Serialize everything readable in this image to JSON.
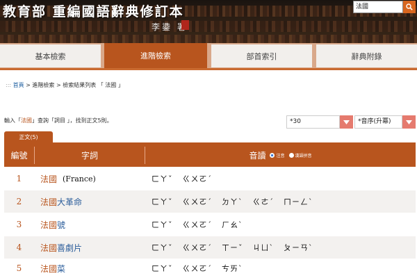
{
  "header": {
    "title": "教育部 重編國語辭典修訂本",
    "author": "李鍌 署",
    "search_value": "法國"
  },
  "nav": {
    "tabs": [
      {
        "label": "基本檢索"
      },
      {
        "label": "進階檢索"
      },
      {
        "label": "部首索引"
      },
      {
        "label": "辭典附錄"
      }
    ]
  },
  "breadcrumb": {
    "dots": ":::",
    "home": "首頁",
    "rest": " > 進階檢索 > 檢索結果列表 「 法國 」"
  },
  "summary": {
    "prefix": "輸入「",
    "term": "法國",
    "middle": "」查詢「詞目 」，找到正文",
    "count": "5",
    "suffix": "則。"
  },
  "controls": {
    "page_size": "*30",
    "sort": "*音序(升冪)"
  },
  "sub_tab": "正文(5)",
  "table": {
    "col_num": "編號",
    "col_word": "字詞",
    "col_sound": "音讀",
    "opt_zhuyin": "注音",
    "opt_pinyin": "漢語拼音",
    "rows": [
      {
        "num": "1",
        "head": "法國",
        "tail": "",
        "note": "(France)",
        "zhuyin": [
          "ㄈㄚˇ",
          "ㄍㄨㄛˊ"
        ]
      },
      {
        "num": "2",
        "head": "法國",
        "tail": "大革命",
        "note": "",
        "zhuyin": [
          "ㄈㄚˇ",
          "ㄍㄨㄛˊ",
          "ㄉㄚˋ",
          "ㄍㄜˊ",
          "ㄇㄧㄥˋ"
        ]
      },
      {
        "num": "3",
        "head": "法國",
        "tail": "號",
        "note": "",
        "zhuyin": [
          "ㄈㄚˇ",
          "ㄍㄨㄛˊ",
          "ㄏㄠˋ"
        ]
      },
      {
        "num": "4",
        "head": "法國",
        "tail": "喜劇片",
        "note": "",
        "zhuyin": [
          "ㄈㄚˇ",
          "ㄍㄨㄛˊ",
          "ㄒㄧˇ",
          "ㄐㄩˋ",
          "ㄆㄧㄢˋ"
        ]
      },
      {
        "num": "5",
        "head": "法國",
        "tail": "菜",
        "note": "",
        "zhuyin": [
          "ㄈㄚˇ",
          "ㄍㄨㄛˊ",
          "ㄘㄞˋ"
        ]
      }
    ]
  },
  "colors": {
    "accent": "#b8551e",
    "nav_bg": "#d9a88a",
    "link_blue": "#2a5c9a"
  }
}
